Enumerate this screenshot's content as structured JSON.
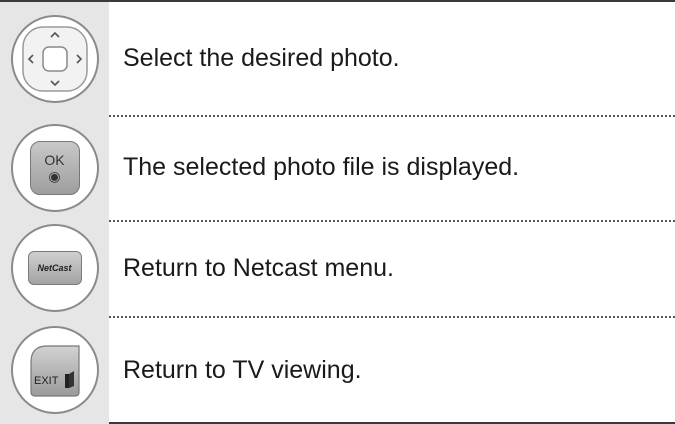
{
  "rows": [
    {
      "icon": "nav-pad-icon",
      "text": "Select the desired photo."
    },
    {
      "icon": "ok-button-icon",
      "icon_label": "OK",
      "icon_glyph": "◉",
      "text": "The selected photo file is displayed."
    },
    {
      "icon": "netcast-button-icon",
      "icon_label": "NetCast",
      "text": "Return to Netcast menu."
    },
    {
      "icon": "exit-button-icon",
      "icon_label": "EXIT",
      "text": "Return to TV viewing."
    }
  ]
}
